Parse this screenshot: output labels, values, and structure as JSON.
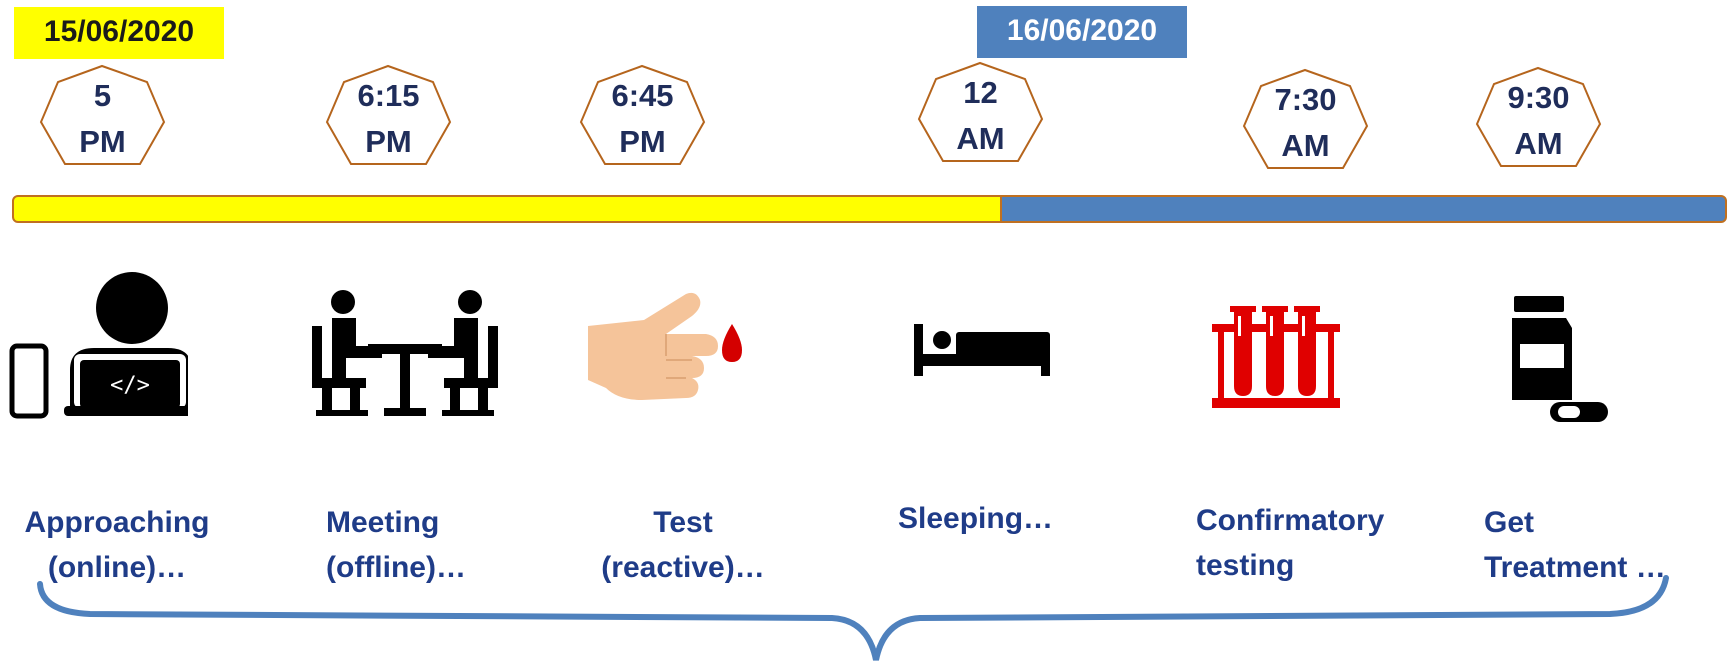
{
  "dates": {
    "day1": "15/06/2020",
    "day2": "16/06/2020"
  },
  "times": [
    {
      "line1": "5",
      "line2": "PM"
    },
    {
      "line1": "6:15",
      "line2": "PM"
    },
    {
      "line1": "6:45",
      "line2": "PM"
    },
    {
      "line1": "12",
      "line2": "AM"
    },
    {
      "line1": "7:30",
      "line2": "AM"
    },
    {
      "line1": "9:30",
      "line2": "AM"
    }
  ],
  "steps": [
    {
      "line1": "Approaching",
      "line2": "(online)…",
      "icon": "person-laptop-phone-icon"
    },
    {
      "line1": "Meeting",
      "line2": "(offline)…",
      "icon": "meeting-icon"
    },
    {
      "line1": "Test",
      "line2": "(reactive)…",
      "icon": "finger-blood-drop-icon"
    },
    {
      "line1": "Sleeping…",
      "line2": "",
      "icon": "bed-icon"
    },
    {
      "line1": "Confirmatory",
      "line2": "testing",
      "icon": "test-tubes-icon"
    },
    {
      "line1": "Get",
      "line2": "Treatment …",
      "icon": "medicine-bottle-icon"
    }
  ],
  "colors": {
    "day1": "#ffff00",
    "day2": "#4f81bd",
    "text": "#1f3c88",
    "outline": "#c07020"
  }
}
